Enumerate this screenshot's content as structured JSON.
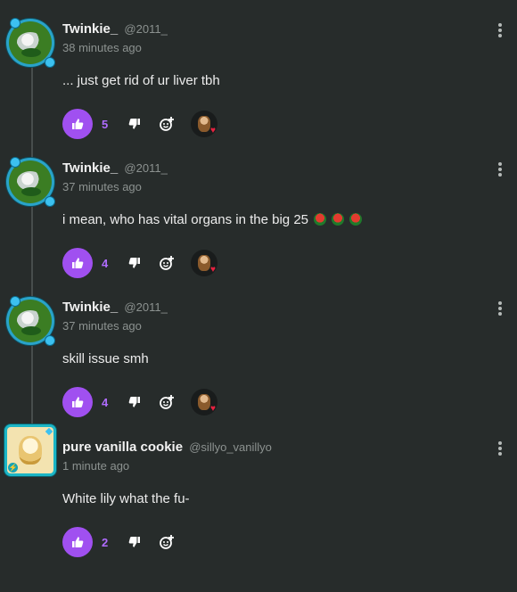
{
  "comments": [
    {
      "name": "Twinkie_",
      "handle": "@2011_",
      "time": "38 minutes ago",
      "text": "... just get rid of ur liver tbh",
      "likes": "5"
    },
    {
      "name": "Twinkie_",
      "handle": "@2011_",
      "time": "37 minutes ago",
      "text": "i mean, who has vital organs in the big 25",
      "likes": "4"
    },
    {
      "name": "Twinkie_",
      "handle": "@2011_",
      "time": "37 minutes ago",
      "text": "skill issue smh",
      "likes": "4"
    },
    {
      "name": "pure vanilla cookie",
      "handle": "@sillyo_vanillyo",
      "time": "1 minute ago",
      "text": "White lily what the fu-",
      "likes": "2"
    }
  ],
  "icons": {
    "like": "thumbs-up-icon",
    "dislike": "thumbs-down-icon",
    "react": "add-reaction-icon",
    "menu": "more-vertical-icon",
    "reaction": "heart-icon"
  },
  "colors": {
    "background": "#272c2b",
    "accent": "#a050f0",
    "like_count": "#b06cff",
    "muted_text": "#8c9290",
    "heart": "#e82240"
  }
}
